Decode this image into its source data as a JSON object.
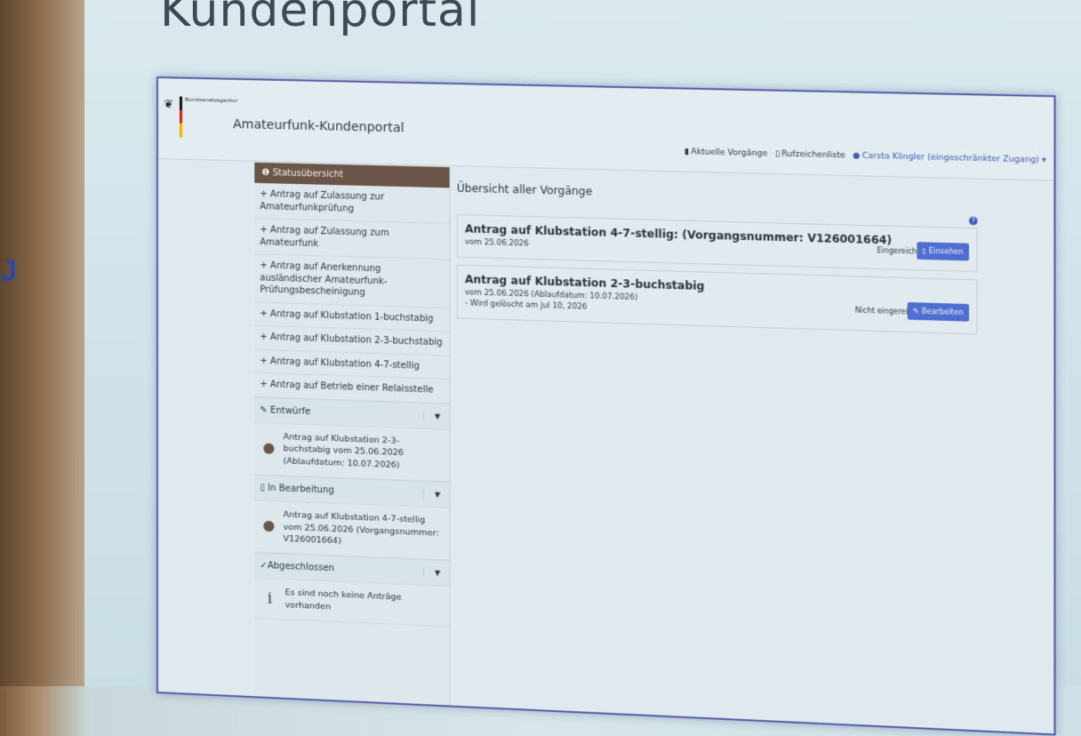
{
  "slide": {
    "title": "Kundenportal",
    "edge_glyph": "J"
  },
  "header": {
    "agency": "Bundesnetzagentur",
    "portal_name": "Amateurfunk-Kundenportal",
    "nav": {
      "current": "Aktuelle Vorgänge",
      "list": "Rufzeichenliste",
      "user": "Carsta Klingler (eingeschränkter Zugang)"
    }
  },
  "sidebar": {
    "status": "Statusübersicht",
    "items": [
      "+ Antrag auf Zulassung zur Amateurfunkprüfung",
      "+ Antrag auf Zulassung zum Amateurfunk",
      "+ Antrag auf Anerkennung ausländischer Amateurfunk-Prüfungsbescheinigung",
      "+ Antrag auf Klubstation 1-buchstabig",
      "+ Antrag auf Klubstation 2-3-buchstabig",
      "+ Antrag auf Klubstation 4-7-stellig",
      "+ Antrag auf Betrieb einer Relaisstelle"
    ],
    "drafts": {
      "label": "Entwürfe",
      "entry": "Antrag auf Klubstation 2-3-buchstabig vom 25.06.2026 (Ablaufdatum: 10.07.2026)"
    },
    "in_progress": {
      "label": "In Bearbeitung",
      "entry": "Antrag auf Klubstation 4-7-stellig vom 25.06.2026 (Vorgangsnummer: V126001664)"
    },
    "completed": {
      "label": "Abgeschlossen",
      "entry": "Es sind noch keine Anträge vorhanden"
    }
  },
  "main": {
    "title": "Übersicht aller Vorgänge",
    "cards": [
      {
        "title": "Antrag auf Klubstation 4-7-stellig: (Vorgangsnummer: V126001664)",
        "sub1": "vom 25.06.2026",
        "sub2": "",
        "status": "Eingereicht",
        "button": "Einsehen"
      },
      {
        "title": "Antrag auf Klubstation 2-3-buchstabig",
        "sub1": "vom 25.06.2026 (Ablaufdatum: 10.07.2026)",
        "sub2": "- Wird gelöscht am Jul 10, 2026",
        "status": "Nicht eingereicht",
        "button": "Bearbeiten"
      }
    ]
  }
}
